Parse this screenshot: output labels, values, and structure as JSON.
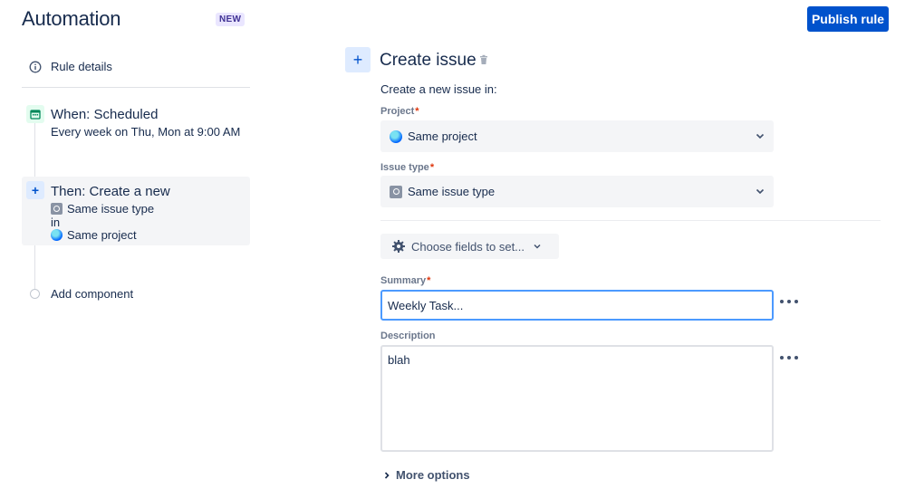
{
  "header": {
    "title": "Automation",
    "badge": "NEW",
    "publish_label": "Publish rule"
  },
  "sidebar": {
    "rule_details_label": "Rule details",
    "trigger": {
      "title": "When: Scheduled",
      "subtitle": "Every week on Thu, Mon at 9:00 AM"
    },
    "action": {
      "title": "Then: Create a new",
      "issue_type": "Same issue type",
      "in_label": "in",
      "project": "Same project"
    },
    "add_component_label": "Add component"
  },
  "main": {
    "title": "Create issue",
    "subheading": "Create a new issue in:",
    "project": {
      "label": "Project",
      "required_mark": "*",
      "value": "Same project"
    },
    "issue_type": {
      "label": "Issue type",
      "required_mark": "*",
      "value": "Same issue type"
    },
    "choose_fields_label": "Choose fields to set...",
    "summary": {
      "label": "Summary",
      "required_mark": "*",
      "value": "Weekly Task..."
    },
    "description": {
      "label": "Description",
      "value": "blah"
    },
    "more_options_label": "More options"
  },
  "colors": {
    "primary": "#0052cc",
    "text": "#172b4d",
    "subtle_text": "#6b778c",
    "required": "#de350b",
    "focus_border": "#4c9aff",
    "field_bg": "#f4f5f7",
    "badge_bg": "#eae6ff",
    "badge_text": "#403294"
  },
  "icons": {
    "rule_details": "info-icon",
    "trigger": "calendar-icon",
    "action": "plus-icon",
    "delete": "trash-icon",
    "fields": "gear-icon",
    "project": "globe-icon",
    "issue_type": "issue-type-icon",
    "dropdown": "chevron-down-icon",
    "more": "ellipsis-icon",
    "expand": "chevron-right-icon"
  }
}
